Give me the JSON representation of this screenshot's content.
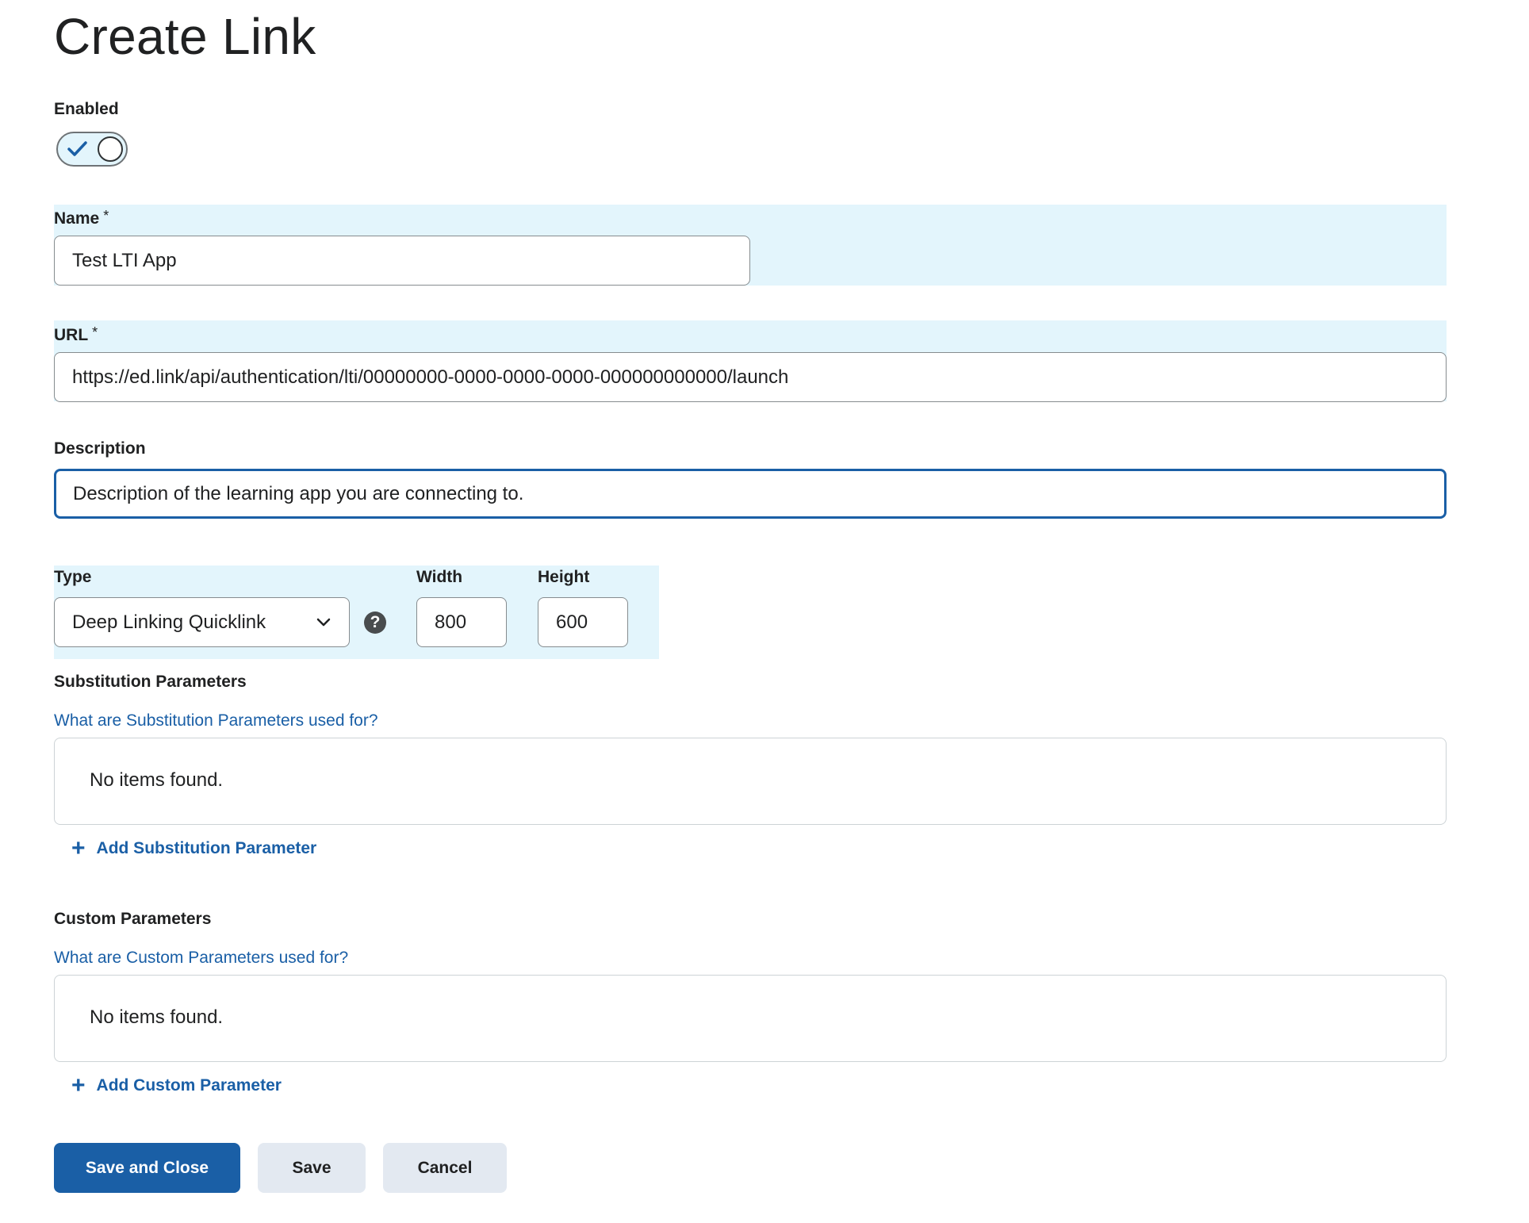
{
  "page": {
    "title": "Create Link"
  },
  "enabled": {
    "label": "Enabled",
    "checked": true
  },
  "name": {
    "label": "Name",
    "required_mark": "*",
    "value": "Test LTI App"
  },
  "url": {
    "label": "URL",
    "required_mark": "*",
    "value": "https://ed.link/api/authentication/lti/00000000-0000-0000-0000-000000000000/launch"
  },
  "description": {
    "label": "Description",
    "value": "Description of the learning app you are connecting to."
  },
  "type": {
    "label": "Type",
    "value": "Deep Linking Quicklink",
    "help_icon": "question-circle-icon"
  },
  "width": {
    "label": "Width",
    "value": "800"
  },
  "height": {
    "label": "Height",
    "value": "600"
  },
  "substitution": {
    "heading": "Substitution Parameters",
    "help_link": "What are Substitution Parameters used for?",
    "empty_text": "No items found.",
    "add_label": "Add Substitution Parameter"
  },
  "custom": {
    "heading": "Custom Parameters",
    "help_link": "What are Custom Parameters used for?",
    "empty_text": "No items found.",
    "add_label": "Add Custom Parameter"
  },
  "buttons": {
    "save_close": "Save and Close",
    "save": "Save",
    "cancel": "Cancel"
  },
  "colors": {
    "accent": "#1a5fa6",
    "highlight": "#e3f5fc",
    "secondary_button": "#e3e9f1"
  }
}
